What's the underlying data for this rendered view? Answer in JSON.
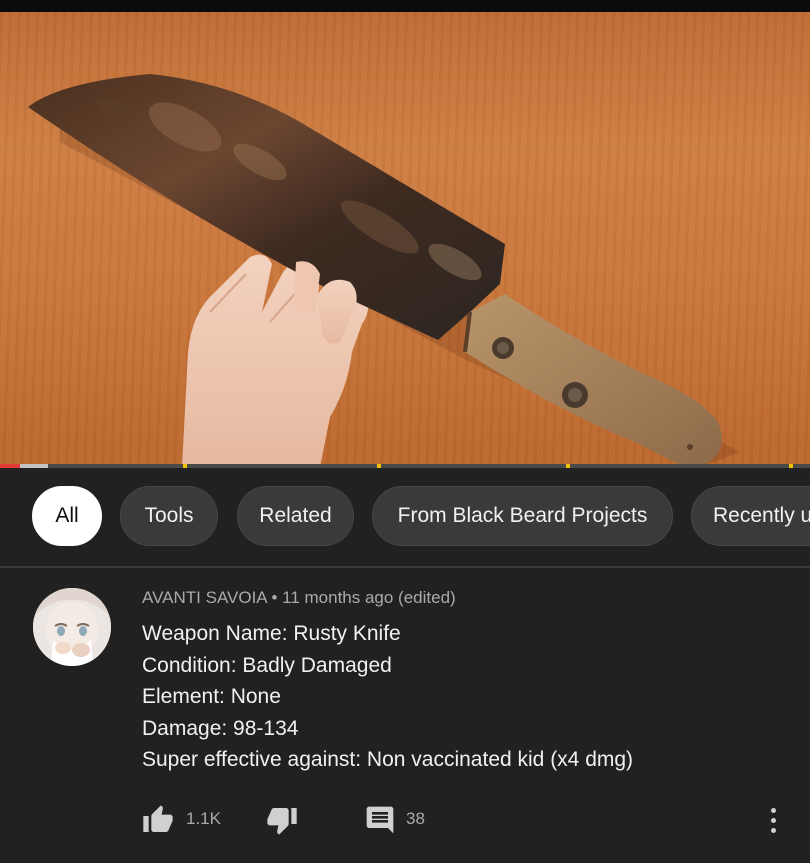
{
  "video": {
    "thumbnail_icon": "rusty-knife-image",
    "progress_played_fraction": 0.025,
    "progress_buffered_fraction": 0.035
  },
  "chips": [
    {
      "label": "All",
      "active": true
    },
    {
      "label": "Tools",
      "active": false
    },
    {
      "label": "Related",
      "active": false
    },
    {
      "label": "From Black Beard Projects",
      "active": false
    },
    {
      "label": "Recently uploaded",
      "active": false
    }
  ],
  "comment": {
    "author": "AVANTI SAVOIA",
    "separator": "•",
    "time": "11 months ago (edited)",
    "lines": [
      "Weapon Name: Rusty Knife",
      "Condition: Badly Damaged",
      "Element: None",
      "Damage: 98-134",
      "Super effective against: Non vaccinated kid (x4 dmg)"
    ],
    "likes": "1.1K",
    "replies": "38",
    "icons": {
      "like": "thumbs-up-icon",
      "dislike": "thumbs-down-icon",
      "reply": "comment-icon",
      "more": "more-vert-icon"
    }
  },
  "colors": {
    "background": "#212121",
    "chip": "#3a3a3a",
    "chip_active": "#ffffff",
    "progress": "#e53935",
    "ad_marker": "#f2c200"
  }
}
